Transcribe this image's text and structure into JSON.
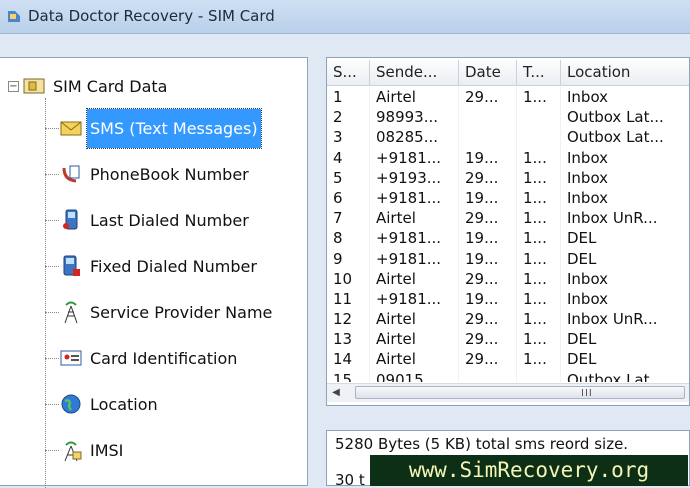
{
  "window": {
    "title": "Data Doctor Recovery - SIM Card"
  },
  "tree": {
    "root_label": "SIM Card Data",
    "items": [
      {
        "label": "SMS (Text Messages)",
        "icon": "envelope-icon",
        "selected": true
      },
      {
        "label": "PhoneBook Number",
        "icon": "phonebook-icon"
      },
      {
        "label": "Last Dialed Number",
        "icon": "last-dialed-icon"
      },
      {
        "label": "Fixed Dialed Number",
        "icon": "fixed-dialed-icon"
      },
      {
        "label": "Service Provider Name",
        "icon": "antenna-icon"
      },
      {
        "label": "Card Identification",
        "icon": "id-card-icon"
      },
      {
        "label": "Location",
        "icon": "globe-icon"
      },
      {
        "label": "IMSI",
        "icon": "imsi-icon"
      }
    ]
  },
  "table": {
    "columns": [
      "S...",
      "Sende...",
      "Date",
      "T...",
      "Location"
    ],
    "rows": [
      [
        "1",
        "Airtel",
        "29...",
        "1...",
        "Inbox"
      ],
      [
        "2",
        "98993...",
        "",
        "",
        "Outbox Lat..."
      ],
      [
        "3",
        "08285...",
        "",
        "",
        "Outbox Lat..."
      ],
      [
        "4",
        "+9181...",
        "19...",
        "1...",
        "Inbox"
      ],
      [
        "5",
        "+9193...",
        "29...",
        "1...",
        "Inbox"
      ],
      [
        "6",
        "+9181...",
        "19...",
        "1...",
        "Inbox"
      ],
      [
        "7",
        "Airtel",
        "29...",
        "1...",
        "Inbox UnR..."
      ],
      [
        "8",
        "+9181...",
        "19...",
        "1...",
        "DEL"
      ],
      [
        "9",
        "+9181...",
        "19...",
        "1...",
        "DEL"
      ],
      [
        "10",
        "Airtel",
        "29...",
        "1...",
        "Inbox"
      ],
      [
        "11",
        "+9181...",
        "19...",
        "1...",
        "Inbox"
      ],
      [
        "12",
        "Airtel",
        "29...",
        "1...",
        "Inbox UnR..."
      ],
      [
        "13",
        "Airtel",
        "29...",
        "1...",
        "DEL"
      ],
      [
        "14",
        "Airtel",
        "29...",
        "1...",
        "DEL"
      ],
      [
        "15",
        "09015",
        "",
        "",
        "Outbox Lat"
      ]
    ]
  },
  "info": {
    "line1": "5280 Bytes (5 KB) total sms reord size.",
    "line2": "30 t"
  },
  "watermark": "www.SimRecovery.org",
  "colors": {
    "selection": "#3399ff",
    "watermark_bg": "#0d2f16"
  }
}
